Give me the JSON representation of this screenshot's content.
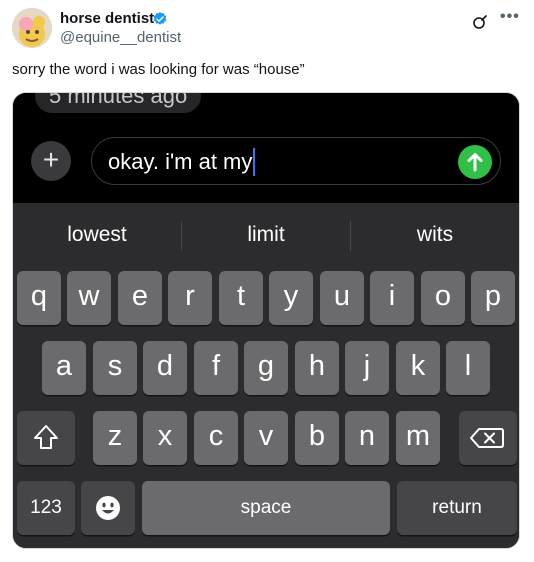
{
  "tweet": {
    "author_name": "horse dentist",
    "handle": "@equine__dentist",
    "text": "sorry the word i was looking for was “house”"
  },
  "icons": {
    "verified": "verified-badge-icon",
    "grok": "grok-icon",
    "more": "more-options-icon"
  },
  "colors": {
    "verified_blue": "#1d9bf0",
    "send_green": "#30c048",
    "cursor_blue": "#3478f6"
  },
  "imessage": {
    "timestamp": "5 minutes ago",
    "plus_label": "+",
    "typed_text": "okay. i'm at my"
  },
  "keyboard": {
    "suggestions": [
      "lowest",
      "limit",
      "wits"
    ],
    "row1": [
      "q",
      "w",
      "e",
      "r",
      "t",
      "y",
      "u",
      "i",
      "o",
      "p"
    ],
    "row2": [
      "a",
      "s",
      "d",
      "f",
      "g",
      "h",
      "j",
      "k",
      "l"
    ],
    "row3": [
      "z",
      "x",
      "c",
      "v",
      "b",
      "n",
      "m"
    ],
    "numbers_label": "123",
    "space_label": "space",
    "return_label": "return"
  }
}
